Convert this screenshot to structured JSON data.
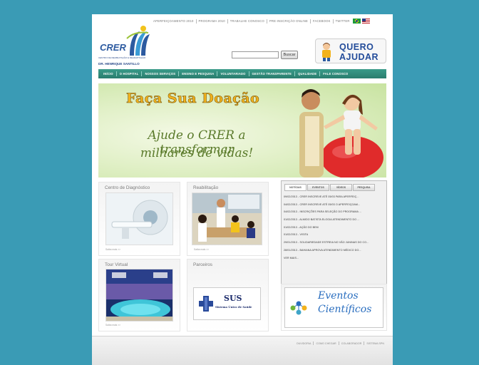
{
  "top_links": [
    "APERFEIÇOAMENTO 2010",
    "PROGRAMA 2010",
    "TRABALHE CONOSCO",
    "PRE-INSCRIÇÃO ONLINE",
    "FACEBOOK",
    "TWITTER"
  ],
  "logo": {
    "acronym": "CRER",
    "subtitle": "CENTRO DE REABILITAÇÃO E READAPTAÇÃO",
    "name": "DR. HENRIQUE SANTILLO"
  },
  "search": {
    "value": "",
    "button_label": "Buscar"
  },
  "quero_ajudar": {
    "line1": "QUERO",
    "line2": "AJUDAR"
  },
  "nav": [
    "INÍCIO",
    "O HOSPITAL",
    "NOSSOS SERVIÇOS",
    "ENSINO E PESQUISA",
    "VOLUNTARIADO",
    "GESTÃO TRANSPARENTE",
    "QUALIDADE",
    "FALE CONOSCO"
  ],
  "banner": {
    "headline": "Faça Sua Doação",
    "line1": "Ajude o CRER a transformar",
    "line2": "milhares de vidas!"
  },
  "boxes": {
    "diagnostico": {
      "title": "Centro de Diagnóstico",
      "more": "Saiba mais >>"
    },
    "reabilitacao": {
      "title": "Reabilitação",
      "more": "Saiba mais >>"
    },
    "tour": {
      "title": "Tour Virtual",
      "more": "Saiba mais >>"
    },
    "parceiros": {
      "title": "Parceiros",
      "sus_name": "SUS",
      "sus_sub": "Sistema Único de Saúde"
    }
  },
  "news": {
    "tabs": [
      "NOTÍCIAS",
      "EVENTOS",
      "VÍDEOS",
      "PESQUISA"
    ],
    "items": [
      "09/02/2013 - CRER INSCREVE ATÉ 05/03 PARA APERFEIÇ...",
      "04/02/2013 - CRER INSCREVE ATÉ 05/03 O APERFEIÇOAM...",
      "04/02/2013 - INSCRIÇÕES PARA SELEÇÃO DO PROGRAMA ...",
      "01/02/2013 - ALMIDO BATISTA ELOGIA ATENDIMENTO DO ...",
      "01/02/2013 - AÇÃO DO BEM",
      "01/02/2013 - VISITA",
      "29/01/2013 - SOLIDARIEDADE ESTREIA NO VÃO JUNINAS DO CO...",
      "28/01/2013 - BAHIANA APROVA ATENDIMENTO MÉDICO DO...",
      "VER MAIS..."
    ]
  },
  "eventos": {
    "line1": "Eventos",
    "line2": "Científicos"
  },
  "footer_links": [
    "OUVIDORIA",
    "COMO CHEGAR",
    "COLABORADOR",
    "SISTEMA SPN"
  ]
}
